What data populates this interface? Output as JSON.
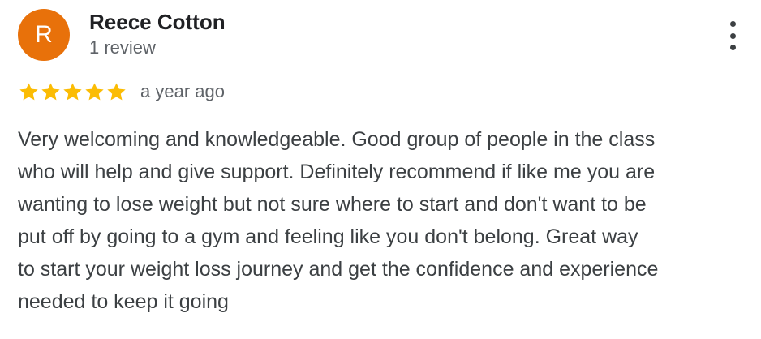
{
  "reviewer": {
    "initial": "R",
    "name": "Reece Cotton",
    "review_count": "1 review",
    "avatar_color": "#e8710a"
  },
  "rating": {
    "stars": 5,
    "max_stars": 5,
    "star_color": "#fbbc04",
    "date": "a year ago"
  },
  "menu": {
    "icon": "more-vert-icon"
  },
  "review": {
    "lines": [
      "Very welcoming and knowledgeable. Good group of people in the class",
      "who will help and give support. Definitely recommend if like me you are",
      "wanting to lose weight but not sure where to start and don't want to be",
      "put off by going to a gym and feeling like you don't belong. Great way",
      "to start your weight loss journey and get the confidence and experience",
      "needed to keep it going"
    ]
  }
}
